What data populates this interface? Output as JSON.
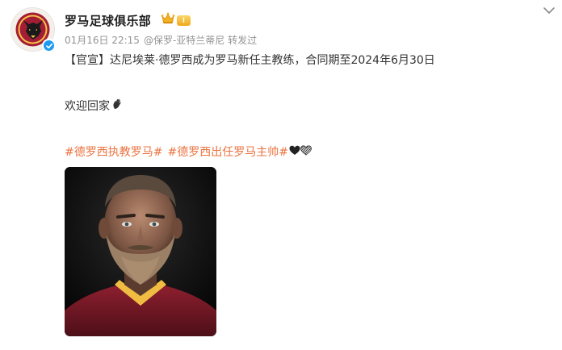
{
  "account": {
    "name": "罗马足球俱乐部",
    "vip_level": "I",
    "timestamp": "01月16日 22:15",
    "source": "@保罗-亚特兰蒂尼 转发过"
  },
  "post": {
    "line1": "【官宣】达尼埃莱·德罗西成为罗马新任主教练，合同期至2024年6月30日",
    "line2": "欢迎回家",
    "topics": [
      "#德罗西执教罗马#",
      "#德罗西出任罗马主帅#"
    ]
  },
  "icons": {
    "avatar": "as-roma-wolf-logo",
    "verified": "verified-check-icon",
    "vip": "vip-crown-icon",
    "wave": "waving-hand-icon",
    "heart_black": "black-heart-icon",
    "heart_striped": "striped-heart-icon",
    "menu": "chevron-down-icon"
  },
  "colors": {
    "topic": "#eb7340",
    "meta": "#939393",
    "verified": "#1d9bf0",
    "roma_red": "#8e1f2f",
    "roma_gold": "#f0bc42"
  }
}
